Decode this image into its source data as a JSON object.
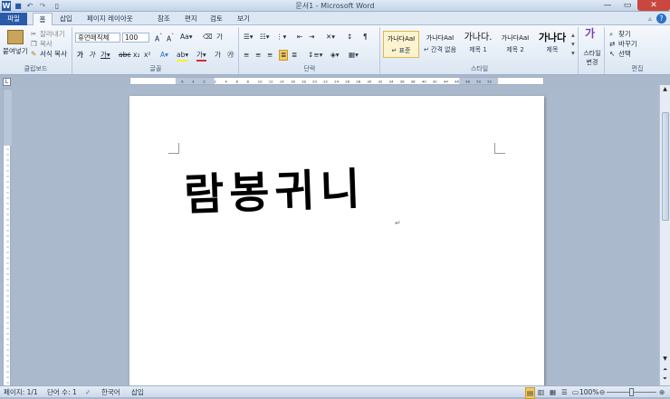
{
  "window": {
    "title": "문서1 - Microsoft Word"
  },
  "tabs": [
    {
      "label": "파일"
    },
    {
      "label": "홈"
    },
    {
      "label": "삽입"
    },
    {
      "label": "페이지 레이아웃"
    },
    {
      "label": "참조"
    },
    {
      "label": "편지"
    },
    {
      "label": "검토"
    },
    {
      "label": "보기"
    }
  ],
  "clipboard": {
    "paste_label": "붙여넣기",
    "cut_label": "잘라내기",
    "copy_label": "복사",
    "format_painter_label": "서식 복사",
    "group_label": "클립보드"
  },
  "font": {
    "name": "휴먼매직체",
    "size": "100",
    "group_label": "글꼴"
  },
  "paragraph": {
    "group_label": "단락"
  },
  "styles": {
    "items": [
      {
        "preview": "가나다AaI",
        "name": "↵ 표준"
      },
      {
        "preview": "가나다AaI",
        "name": "↵ 간격 없음"
      },
      {
        "preview": "가나다.",
        "name": "제목 1"
      },
      {
        "preview": "가나다AaI",
        "name": "제목 2"
      },
      {
        "preview": "가나다",
        "name": "제목"
      }
    ],
    "change_label": "스타일 변경",
    "group_label": "스타일"
  },
  "editing": {
    "find_label": "찾기",
    "replace_label": "바꾸기",
    "select_label": "선택",
    "group_label": "편집"
  },
  "ruler": {
    "labels": [
      "6",
      "4",
      "2",
      "2",
      "4",
      "6",
      "8",
      "10",
      "12",
      "14",
      "16",
      "18",
      "20",
      "22",
      "24",
      "26",
      "28",
      "30",
      "32",
      "34",
      "36",
      "38",
      "40",
      "42",
      "44",
      "46",
      "48",
      "50",
      "52"
    ]
  },
  "document": {
    "text": "람봉귀니",
    "para_mark": "↵"
  },
  "status": {
    "page": "페이지: 1/1",
    "words": "단어 수: 1",
    "language": "한국어",
    "mode": "삽입",
    "zoom": "100%"
  },
  "colors": {
    "accent": "#2a5aa8",
    "close": "#c9473f"
  }
}
